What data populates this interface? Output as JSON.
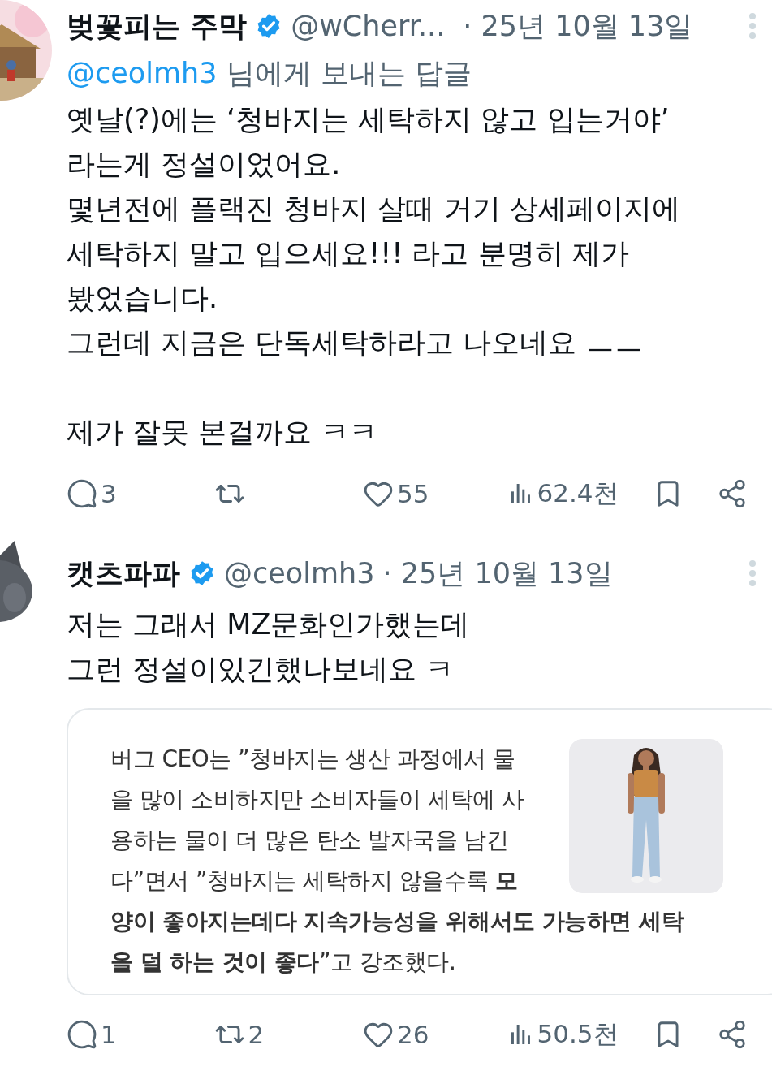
{
  "tweets": [
    {
      "author": {
        "name": "벚꽃피는 주막",
        "handle": "@wCherr...",
        "verified": true
      },
      "date": "· 25년 10월 13일",
      "reply_to": {
        "mention": "@ceolmh3",
        "text": "님에게 보내는 답글"
      },
      "body": "옛날(?)에는 ‘청바지는 세탁하지 않고 입는거야’\n라는게 정설이었어요.\n몇년전에 플랙진 청바지 살때 거기 상세페이지에\n세탁하지 말고 입으세요!!! 라고 분명히 제가\n봤었습니다.\n그런데 지금은 단독세탁하라고 나오네요 ㅡㅡ\n\n제가 잘못 본걸까요 ㅋㅋ",
      "actions": [
        {
          "kind": "reply",
          "count": "3"
        },
        {
          "kind": "repost"
        },
        {
          "kind": "like",
          "count": "55"
        },
        {
          "kind": "views",
          "count": "62.4천"
        },
        {
          "kind": "bookmark"
        },
        {
          "kind": "share"
        }
      ]
    },
    {
      "author": {
        "name": "캣츠파파",
        "handle": "@ceolmh3",
        "verified": true
      },
      "date": "· 25년 10월 13일",
      "body": "저는 그래서 MZ문화인가했는데\n그런 정설이있긴했나보네요 ㅋ",
      "card": {
        "text_beside_picture": "버그 CEO는 ”청바지는 생산 과정에서 물\n을 많이 소비하지만 소비자들이 세탁에 사\n용하는 물이 더 많은 탄소 발자국을 남긴\n다”면서 ”청바지는 세탁하지 않을수록 **모**",
        "text_below_picture": "**양이 좋아지는데다 지속가능성을 위해서도 가능하면 세탁**\n**을 덜 하는 것이 좋다**”고 강조했다."
      },
      "actions": [
        {
          "kind": "reply",
          "count": "1"
        },
        {
          "kind": "repost",
          "count": "2"
        },
        {
          "kind": "like",
          "count": "26"
        },
        {
          "kind": "views",
          "count": "50.5천"
        },
        {
          "kind": "bookmark"
        },
        {
          "kind": "share"
        }
      ]
    }
  ]
}
